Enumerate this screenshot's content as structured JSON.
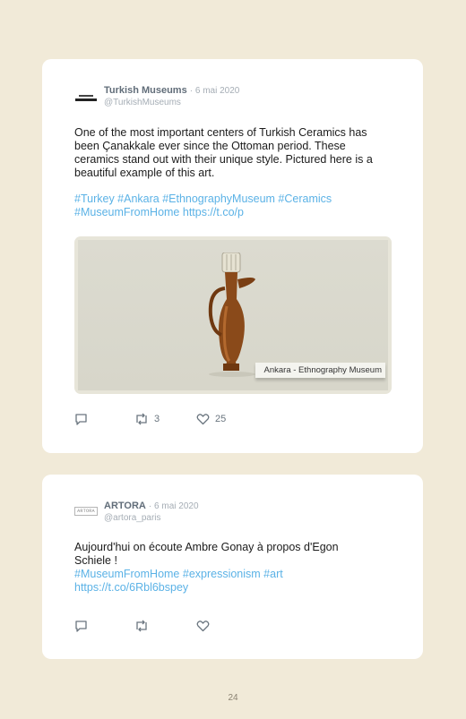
{
  "tweets": [
    {
      "avatar_icon": "turkish-museums-logo",
      "display_name": "Turkish Museums",
      "date": "· 6 mai 2020",
      "handle": "@TurkishMuseums",
      "text_lines": [
        "One of the most important centers of Turkish Ceramics has",
        "been Çanakkale ever since the Ottoman period. These",
        "ceramics stand out with their unique style. Pictured here is a",
        "beautiful example of this art."
      ],
      "link_lines": [
        "#Turkey #Ankara #EthnographyMuseum #Ceramics",
        "#MuseumFromHome https://t.co/p"
      ],
      "media_caption": "Ankara - Ethnography Museum",
      "reply_icon": "reply-icon",
      "retweet_icon": "retweet-icon",
      "retweet_count": "3",
      "like_icon": "heart-icon",
      "like_count": "25"
    },
    {
      "avatar_icon": "artora-logo",
      "avatar_text": "ARTORA",
      "display_name": "ARTORA",
      "date": "· 6 mai 2020",
      "handle": "@artora_paris",
      "text_lines": [
        "Aujourd'hui on écoute Ambre Gonay à propos d'Egon",
        "Schiele !"
      ],
      "link_lines": [
        "#MuseumFromHome #expressionism #art",
        "https://t.co/6Rbl6bspey"
      ],
      "reply_icon": "reply-icon",
      "retweet_icon": "retweet-icon",
      "retweet_count": "",
      "like_icon": "heart-icon",
      "like_count": ""
    }
  ],
  "page_number": "24",
  "colors": {
    "background": "#f1ead8",
    "card": "#ffffff",
    "link": "#5bb2e6",
    "name": "#616d79",
    "muted": "#a5adb5"
  }
}
